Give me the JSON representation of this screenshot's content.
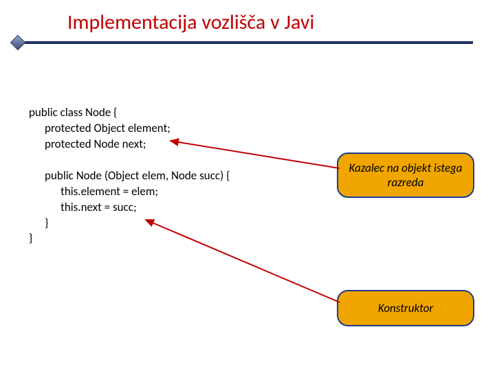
{
  "title": "Implementacija vozlišča v Javi",
  "code": {
    "line1": "public class Node {",
    "line2": "      protected Object element;",
    "line3": "      protected Node next;",
    "line4": "",
    "line5": "      public Node (Object elem, Node succ) {",
    "line6": "            this.element = elem;",
    "line7": "            this.next = succ;",
    "line8": "      }",
    "line9": "}"
  },
  "callout1": {
    "line1": "Kazalec na objekt istega",
    "line2": "razreda"
  },
  "callout2": {
    "text": "Konstruktor"
  }
}
